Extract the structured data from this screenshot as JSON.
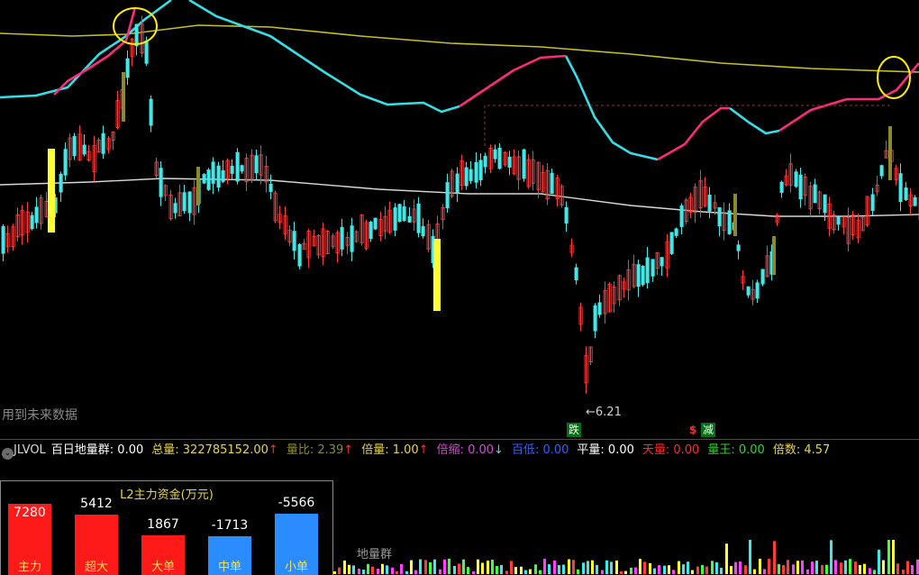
{
  "notice": "用到未来数据",
  "low_marker": "←6.21",
  "signals": {
    "die": "跌",
    "s": "$",
    "jian": "减"
  },
  "indicator_bar": {
    "name": "JLVOL",
    "items": [
      {
        "label": "百日地量群:",
        "value": "0.00",
        "color": "#ffffff",
        "arrow": ""
      },
      {
        "label": "总量:",
        "value": "322785152.00",
        "color": "#e8d44a",
        "arrow": "↑"
      },
      {
        "label": "量比:",
        "value": "2.39",
        "color": "#8a8a3a",
        "arrow": "↑"
      },
      {
        "label": "倍量:",
        "value": "1.00",
        "color": "#e8d44a",
        "arrow": "↑"
      },
      {
        "label": "倍缩:",
        "value": "0.00",
        "color": "#e040e0",
        "arrow": "↓"
      },
      {
        "label": "百低:",
        "value": "0.00",
        "color": "#3060ff",
        "arrow": ""
      },
      {
        "label": "平量:",
        "value": "0.00",
        "color": "#ffffff",
        "arrow": ""
      },
      {
        "label": "天量:",
        "value": "0.00",
        "color": "#ff2a2a",
        "arrow": ""
      },
      {
        "label": "量王:",
        "value": "0.00",
        "color": "#30d030",
        "arrow": ""
      },
      {
        "label": "倍数:",
        "value": "4.57",
        "color": "#e8d44a",
        "arrow": ""
      }
    ],
    "arrow_up_color": "#ff3030",
    "arrow_down_color": "#40e0e0"
  },
  "volume_label": "地量群",
  "fund_panel": {
    "title": "L2主力资金(万元)",
    "bars": [
      {
        "label": "主力",
        "value": "7280",
        "num": 7280,
        "color": "#ff1a1a"
      },
      {
        "label": "超大",
        "value": "5412",
        "num": 5412,
        "color": "#ff1a1a"
      },
      {
        "label": "大单",
        "value": "1867",
        "num": 1867,
        "color": "#ff1a1a"
      },
      {
        "label": "中单",
        "value": "-1713",
        "num": -1713,
        "color": "#2b8cff"
      },
      {
        "label": "小单",
        "value": "-5566",
        "num": -5566,
        "color": "#2b8cff"
      }
    ]
  },
  "colors": {
    "up": "#ff3b3b",
    "down": "#40e8e8",
    "yellow": "#ffff33",
    "olive": "#8a8a2a",
    "line_magenta": "#ff2a7a",
    "line_cyan": "#33e0e8",
    "line_yellow": "#c8c020",
    "line_white": "#d8d8d8",
    "highlight": "#ffee00"
  }
}
